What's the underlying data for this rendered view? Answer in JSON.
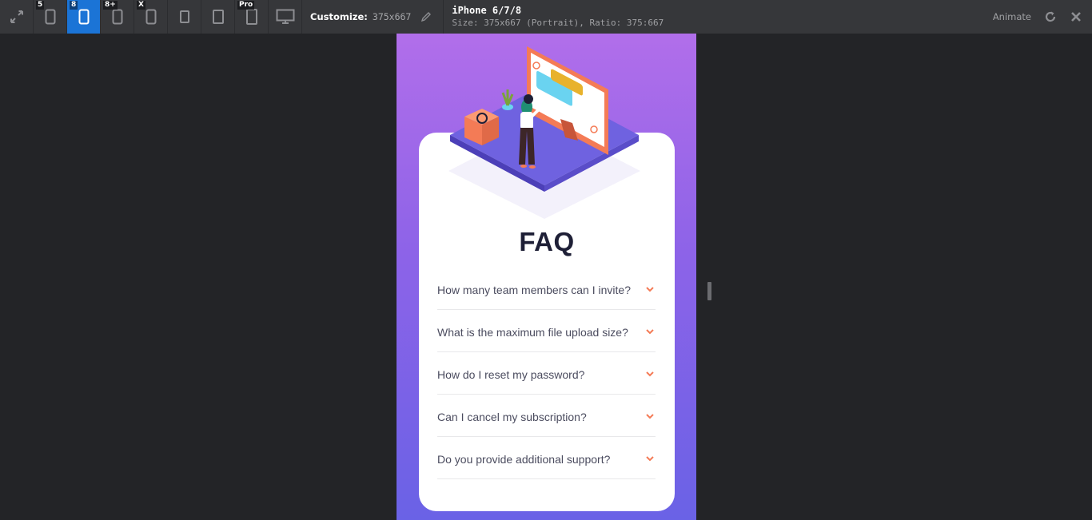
{
  "toolbar": {
    "devices": [
      {
        "badge": "",
        "name": "fullscreen"
      },
      {
        "badge": "5",
        "name": "iphone-5"
      },
      {
        "badge": "8",
        "name": "iphone-8",
        "active": true
      },
      {
        "badge": "8+",
        "name": "iphone-8-plus"
      },
      {
        "badge": "X",
        "name": "iphone-x"
      },
      {
        "badge": "",
        "name": "ipad"
      },
      {
        "badge": "",
        "name": "ipad-landscape"
      },
      {
        "badge": "Pro",
        "name": "ipad-pro"
      },
      {
        "badge": "",
        "name": "desktop"
      }
    ],
    "customize_label": "Customize:",
    "customize_value": "375x667",
    "device_name": "iPhone 6/7/8",
    "device_size": "Size: 375x667 (Portrait), Ratio: 375:667",
    "animate_label": "Animate",
    "accent_color": "#1b74d6"
  },
  "page": {
    "title": "FAQ",
    "questions": [
      "How many team members can I invite?",
      "What is the maximum file upload size?",
      "How do I reset my password?",
      "Can I cancel my subscription?",
      "Do you provide additional support?"
    ],
    "chevron_color": "#f47b56",
    "title_color": "#1e1f36",
    "gradient_top": "#b16eea",
    "gradient_bottom": "#6a62e6"
  }
}
